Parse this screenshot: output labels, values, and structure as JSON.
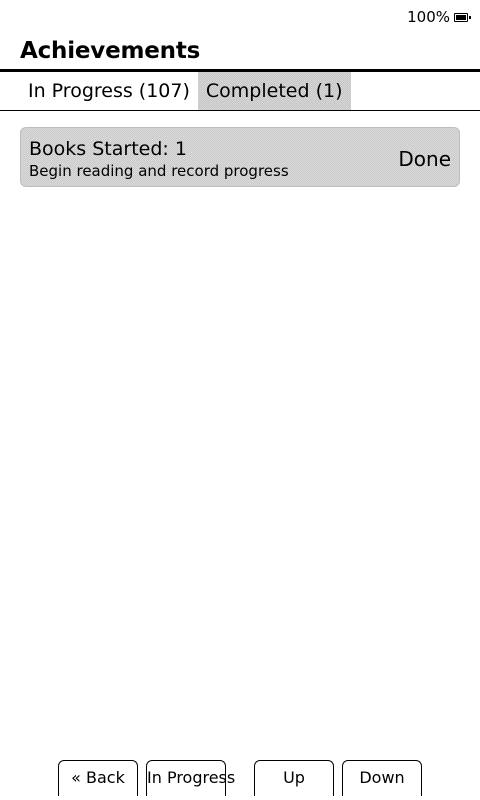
{
  "status": {
    "battery_percent": "100%",
    "battery_icon": "battery-charging-icon"
  },
  "page": {
    "title": "Achievements"
  },
  "tabs": [
    {
      "label": "In Progress (107)",
      "active": false
    },
    {
      "label": "Completed (1)",
      "active": true
    }
  ],
  "achievements": [
    {
      "title": "Books Started: 1",
      "description": "Begin reading and record progress",
      "status": "Done"
    }
  ],
  "footer": {
    "back_label": "« Back",
    "in_progress_label": "In Progress",
    "up_label": "Up",
    "down_label": "Down"
  }
}
